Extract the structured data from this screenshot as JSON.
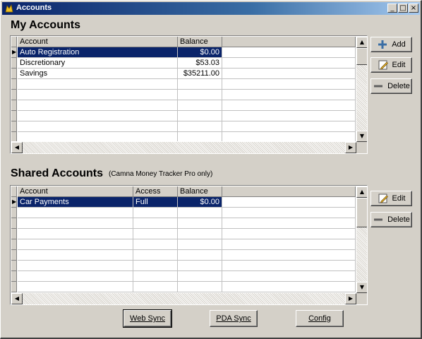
{
  "window": {
    "title": "Accounts"
  },
  "titlebar_buttons": {
    "minimize": "_",
    "maximize": "□",
    "close": "×"
  },
  "my_accounts": {
    "title": "My Accounts",
    "columns": [
      "Account",
      "Balance"
    ],
    "rows": [
      {
        "account": "Auto Registration",
        "balance": "$0.00",
        "selected": true
      },
      {
        "account": "Discretionary",
        "balance": "$53.03",
        "selected": false
      },
      {
        "account": "Savings",
        "balance": "$35211.00",
        "selected": false
      }
    ],
    "buttons": {
      "add": "Add",
      "edit": "Edit",
      "delete": "Delete"
    }
  },
  "shared_accounts": {
    "title": "Shared Accounts",
    "note": "(Camna Money Tracker Pro only)",
    "columns": [
      "Account",
      "Access",
      "Balance"
    ],
    "rows": [
      {
        "account": "Car Payments",
        "access": "Full",
        "balance": "$0.00",
        "selected": true
      }
    ],
    "buttons": {
      "edit": "Edit",
      "delete": "Delete"
    }
  },
  "footer_buttons": {
    "web_sync": "Web Sync",
    "pda_sync": "PDA Sync",
    "config": "Config"
  },
  "colors": {
    "selection": "#0a246a",
    "face": "#d4d0c8",
    "title_start": "#0a246a"
  }
}
